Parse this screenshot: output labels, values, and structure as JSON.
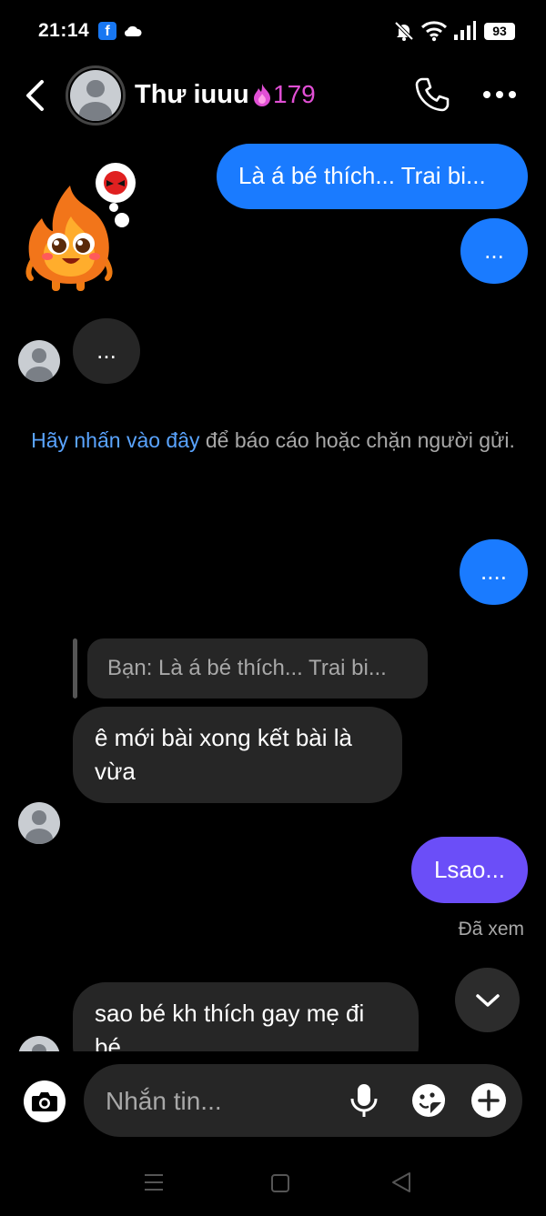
{
  "status_bar": {
    "time": "21:14",
    "fb_badge": "f",
    "battery": "93",
    "icons": [
      "facebook-icon",
      "cloud-icon",
      "bell-muted-icon",
      "wifi-icon",
      "signal-icon",
      "battery-icon"
    ]
  },
  "header": {
    "contact_name": "Thư iuuu",
    "streak_count": "179",
    "icons": [
      "back-arrow-icon",
      "phone-icon",
      "more-icon"
    ]
  },
  "messages": {
    "sent_1": "Là á bé thích... Trai bi...",
    "sent_2": "...",
    "received_1": "...",
    "sent_3": "....",
    "reply_preview": "Bạn: Là á bé thích... Trai bi...",
    "received_2": "ê mới bài xong kết bài là vừa",
    "sent_4": "Lsao...",
    "seen_status": "Đã xem",
    "received_3": "sao bé kh thích gay mẹ đi bé"
  },
  "report_notice": {
    "link_text": "Hãy nhấn vào đây",
    "rest_text": " để báo cáo hoặc chặn người gửi."
  },
  "composer": {
    "placeholder": "Nhắn tin..."
  },
  "colors": {
    "sent_blue": "#1a7bff",
    "sent_purple": "#6b4ef8",
    "received_gray": "#262626",
    "streak_pink": "#e14fd5",
    "link_blue": "#5aa4ff"
  }
}
